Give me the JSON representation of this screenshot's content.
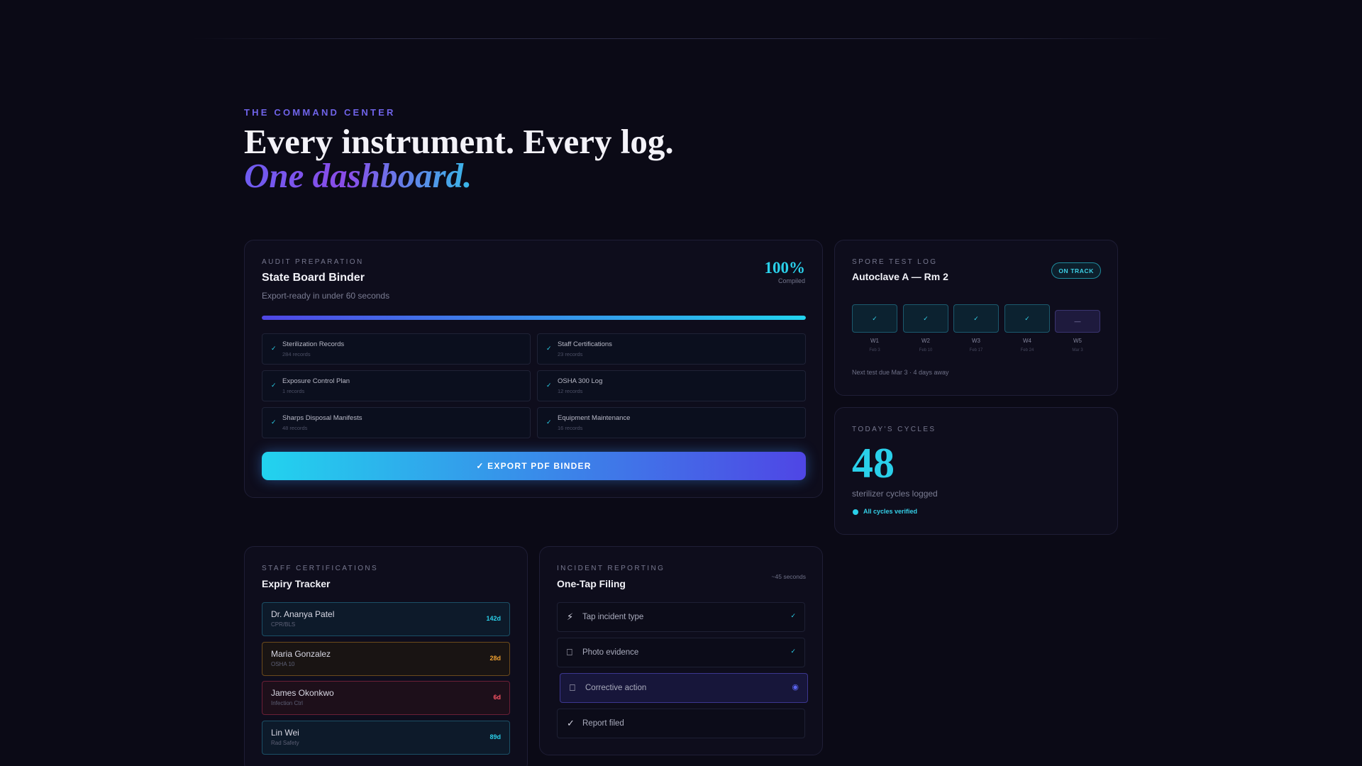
{
  "hero": {
    "eyebrow": "THE COMMAND CENTER",
    "line1": "Every instrument. Every log.",
    "line2": "One dashboard."
  },
  "audit": {
    "label": "AUDIT PREPARATION",
    "title": "State Board Binder",
    "subtitle": "Export-ready in under 60 seconds",
    "percent": "100%",
    "percent_sub": "Compiled",
    "progress": 1.0,
    "records": [
      {
        "name": "Sterilization Records",
        "count": "284 records"
      },
      {
        "name": "Staff Certifications",
        "count": "23 records"
      },
      {
        "name": "Exposure Control Plan",
        "count": "1 records"
      },
      {
        "name": "OSHA 300 Log",
        "count": "12 records"
      },
      {
        "name": "Sharps Disposal Manifests",
        "count": "48 records"
      },
      {
        "name": "Equipment Maintenance",
        "count": "16 records"
      }
    ],
    "check_glyph": "✓",
    "export_label": "✓ EXPORT PDF BINDER"
  },
  "spore": {
    "label": "SPORE TEST LOG",
    "title": "Autoclave A — Rm 2",
    "badge": "ON TRACK",
    "weeks": [
      {
        "mark": "✓",
        "label": "W1",
        "date": "Feb 3"
      },
      {
        "mark": "✓",
        "label": "W2",
        "date": "Feb 10"
      },
      {
        "mark": "✓",
        "label": "W3",
        "date": "Feb 17"
      },
      {
        "mark": "✓",
        "label": "W4",
        "date": "Feb 24"
      },
      {
        "mark": "—",
        "label": "W5",
        "date": "Mar 3"
      }
    ],
    "next": "Next test due Mar 3 · 4 days away"
  },
  "cycles": {
    "label": "TODAY'S CYCLES",
    "value": "48",
    "subtitle": "sterilizer cycles logged",
    "status": "All cycles verified"
  },
  "staff": {
    "label": "STAFF CERTIFICATIONS",
    "title": "Expiry Tracker",
    "people": [
      {
        "name": "Dr. Ananya Patel",
        "role": "CPR/BLS",
        "days": "142d",
        "level": "ok"
      },
      {
        "name": "Maria Gonzalez",
        "role": "OSHA 10",
        "days": "28d",
        "level": "warn"
      },
      {
        "name": "James Okonkwo",
        "role": "Infection Ctrl",
        "days": "6d",
        "level": "crit"
      },
      {
        "name": "Lin Wei",
        "role": "Rad Safety",
        "days": "89d",
        "level": "ok"
      }
    ]
  },
  "incident": {
    "label": "INCIDENT REPORTING",
    "title": "One-Tap Filing",
    "eta": "~45 seconds",
    "steps": [
      {
        "icon": "⚡",
        "icon_name": "lightning-icon",
        "text": "Tap incident type",
        "status": "✓"
      },
      {
        "icon": "⎕",
        "icon_name": "photo-icon",
        "text": "Photo evidence",
        "status": "✓"
      },
      {
        "icon": "⎕",
        "icon_name": "clipboard-icon",
        "text": "Corrective action",
        "status": "◉"
      },
      {
        "icon": "✓",
        "icon_name": "check-icon",
        "text": "Report filed",
        "status": ""
      }
    ]
  },
  "colors": {
    "accent_cyan": "#2ad0ea",
    "accent_indigo": "#4f46e5",
    "warn": "#f0a130",
    "critical": "#ff5566"
  }
}
